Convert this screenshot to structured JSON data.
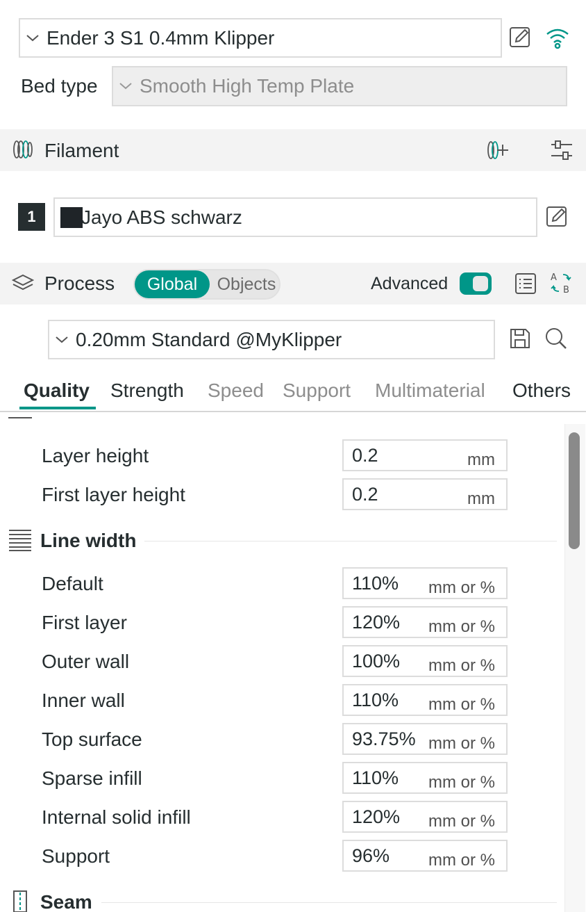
{
  "printer": {
    "preset": "Ender 3 S1 0.4mm Klipper",
    "bed_type_label": "Bed type",
    "bed_type_value": "Smooth High Temp Plate"
  },
  "filament": {
    "title": "Filament",
    "items": [
      {
        "index": "1",
        "name": "Jayo ABS schwarz",
        "color": "#1f2428"
      }
    ]
  },
  "process": {
    "title": "Process",
    "global_label": "Global",
    "objects_label": "Objects",
    "advanced_label": "Advanced",
    "advanced_on": true,
    "preset": "0.20mm Standard @MyKlipper"
  },
  "tabs": [
    "Quality",
    "Strength",
    "Speed",
    "Support",
    "Multimaterial",
    "Others"
  ],
  "active_tab": "Quality",
  "layer_height": {
    "rows": [
      {
        "label": "Layer height",
        "value": "0.2",
        "unit": "mm"
      },
      {
        "label": "First layer height",
        "value": "0.2",
        "unit": "mm"
      }
    ]
  },
  "line_width": {
    "title": "Line width",
    "rows": [
      {
        "label": "Default",
        "value": "110%",
        "unit": "mm or %"
      },
      {
        "label": "First layer",
        "value": "120%",
        "unit": "mm or %"
      },
      {
        "label": "Outer wall",
        "value": "100%",
        "unit": "mm or %"
      },
      {
        "label": "Inner wall",
        "value": "110%",
        "unit": "mm or %"
      },
      {
        "label": "Top surface",
        "value": "93.75%",
        "unit": "mm or %"
      },
      {
        "label": "Sparse infill",
        "value": "110%",
        "unit": "mm or %"
      },
      {
        "label": "Internal solid infill",
        "value": "120%",
        "unit": "mm or %"
      },
      {
        "label": "Support",
        "value": "96%",
        "unit": "mm or %"
      }
    ]
  },
  "seam": {
    "title": "Seam"
  },
  "colors": {
    "accent": "#009688",
    "text": "#262e30",
    "muted": "#8d8d8d"
  }
}
